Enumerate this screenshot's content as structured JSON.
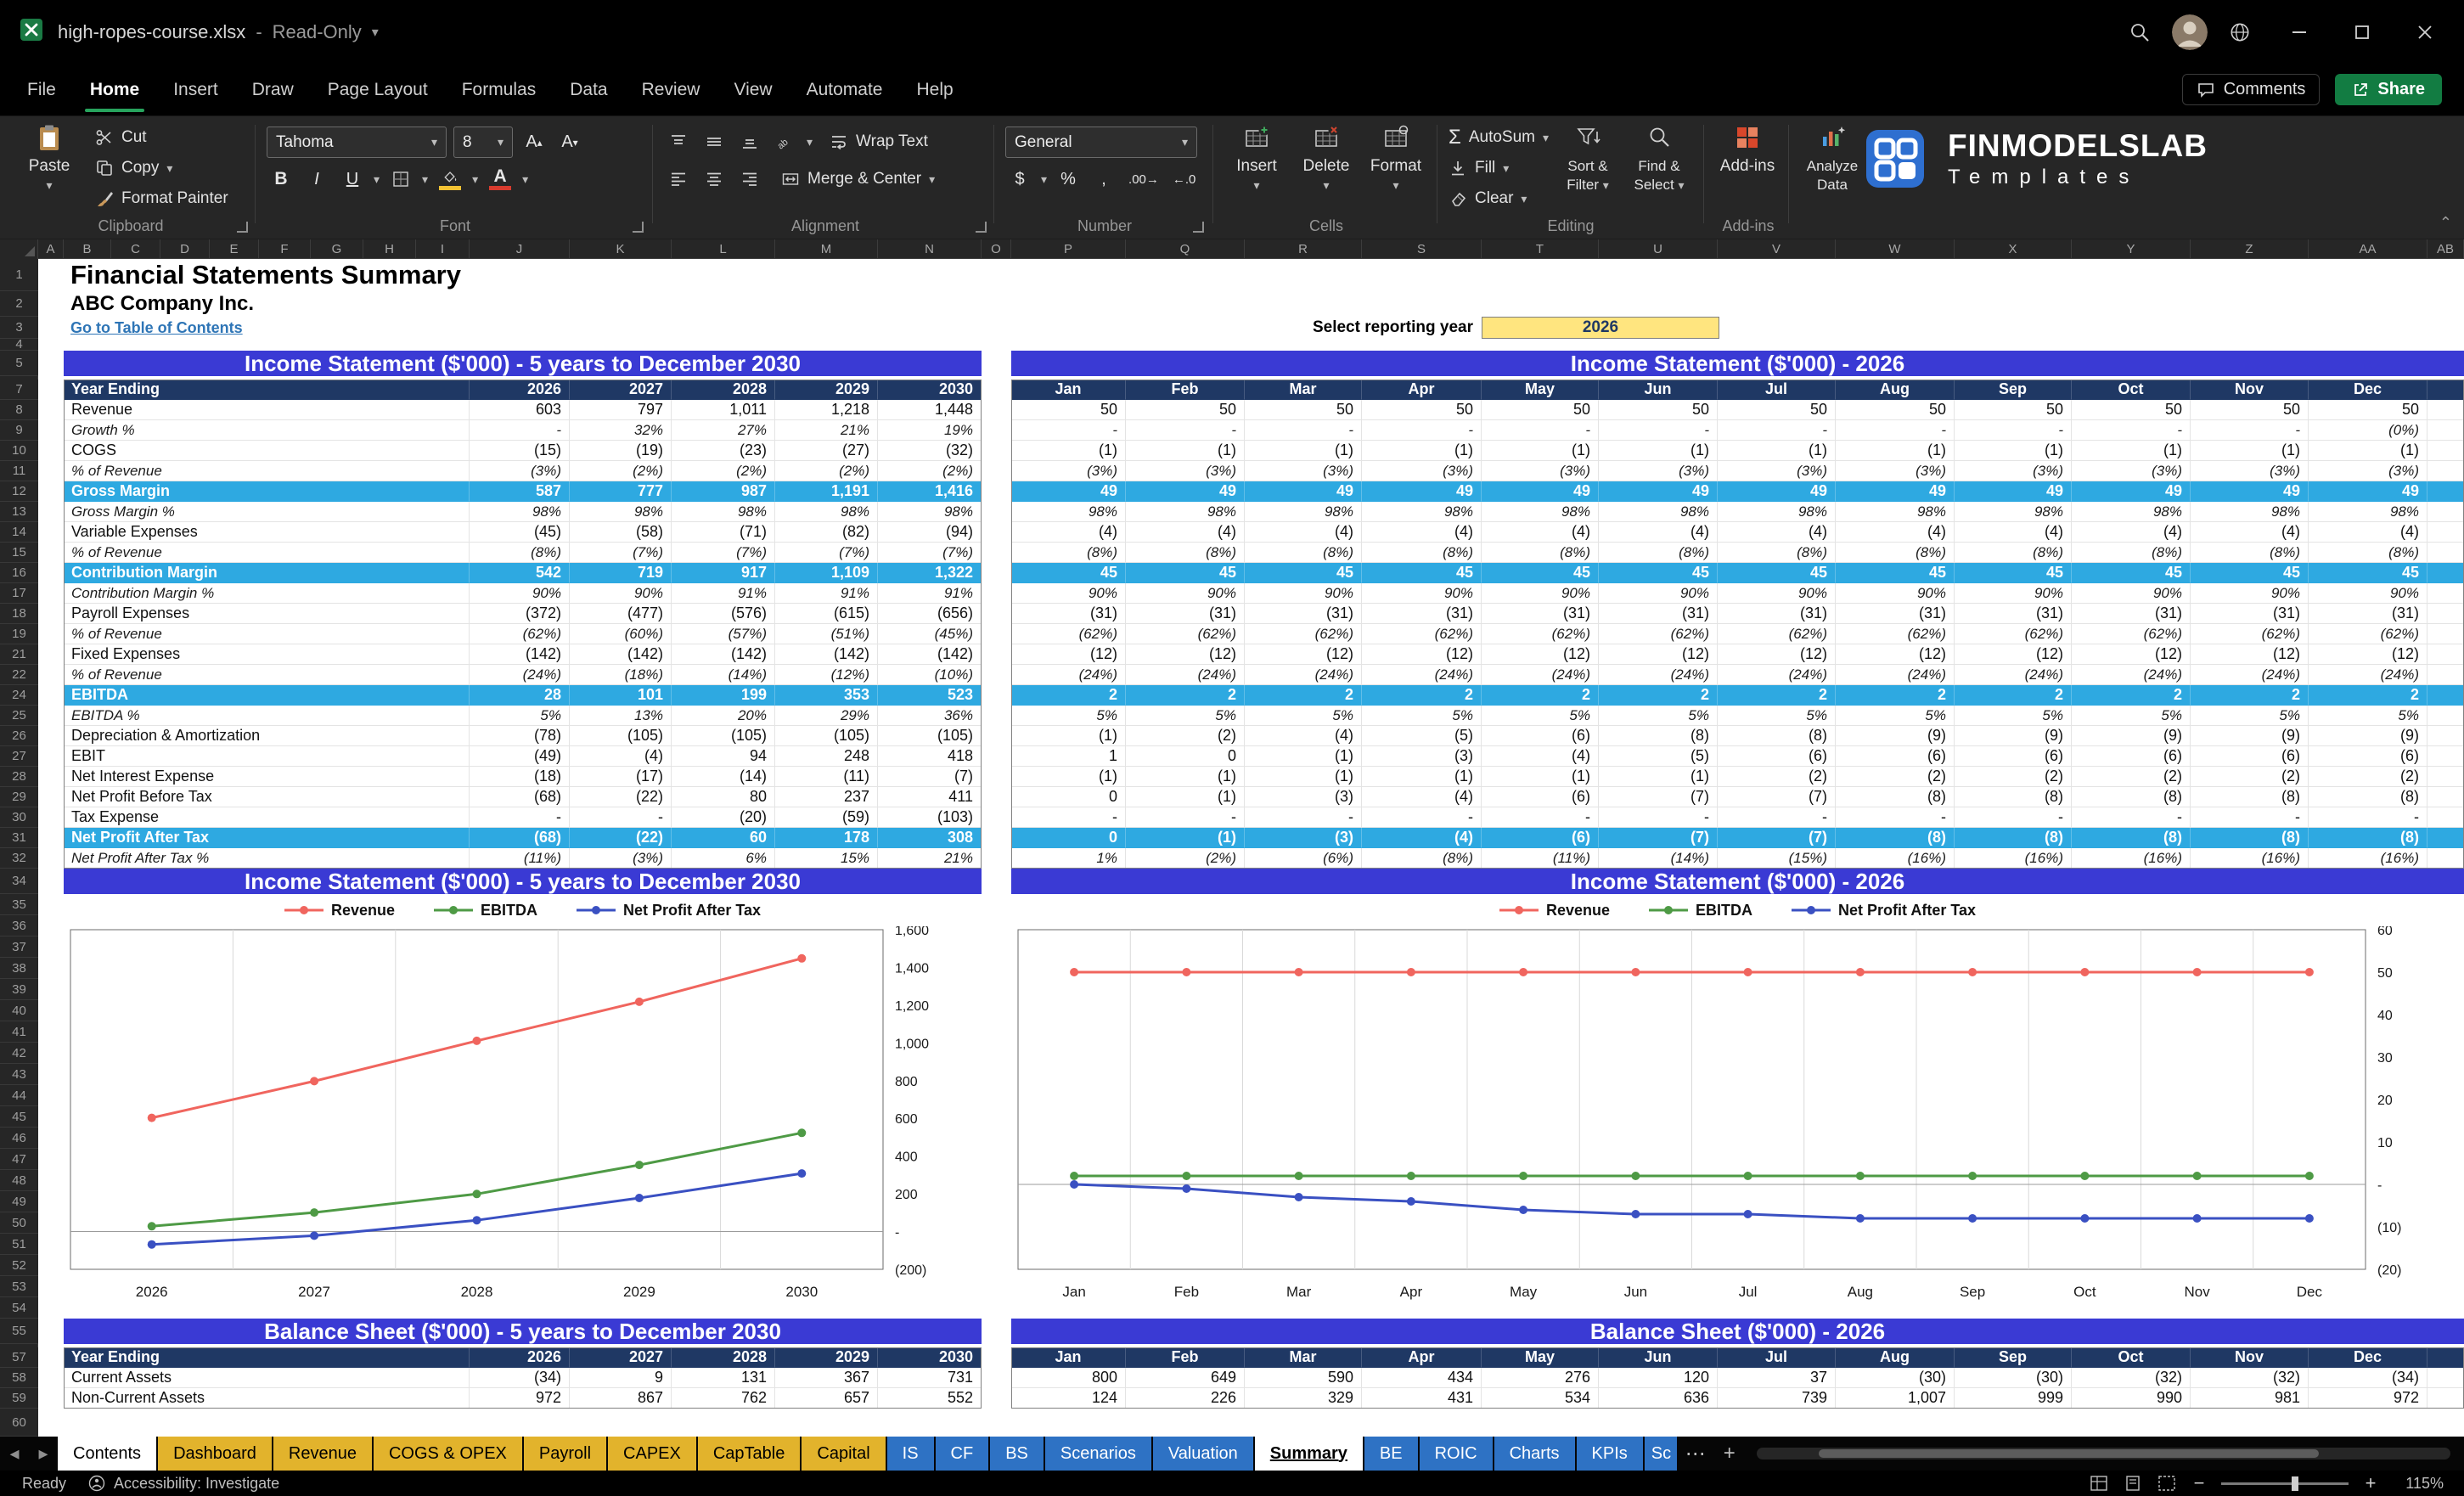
{
  "window": {
    "title": "high-ropes-course.xlsx",
    "mode": "Read-Only"
  },
  "menu": {
    "items": [
      "File",
      "Home",
      "Insert",
      "Draw",
      "Page Layout",
      "Formulas",
      "Data",
      "Review",
      "View",
      "Automate",
      "Help"
    ],
    "active": "Home",
    "comments_label": "Comments",
    "share_label": "Share"
  },
  "ribbon": {
    "clipboard": {
      "label": "Clipboard",
      "paste": "Paste",
      "cut": "Cut",
      "copy": "Copy",
      "format_painter": "Format Painter"
    },
    "font": {
      "label": "Font",
      "family": "Tahoma",
      "size": "8"
    },
    "alignment": {
      "label": "Alignment",
      "wrap_text": "Wrap Text",
      "merge_center": "Merge & Center"
    },
    "number": {
      "label": "Number",
      "format": "General"
    },
    "cells": {
      "label": "Cells",
      "insert": "Insert",
      "delete": "Delete",
      "format": "Format"
    },
    "editing": {
      "label": "Editing",
      "autosum": "AutoSum",
      "fill": "Fill",
      "clear": "Clear",
      "sort_filter": "Sort & Filter",
      "find_select": "Find & Select"
    },
    "addins": {
      "label": "Add-ins",
      "addins": "Add-ins",
      "analyze": "Analyze Data"
    },
    "brand": {
      "name": "FINMODELSLAB",
      "sub": "Templates"
    }
  },
  "sheet": {
    "col_letters": [
      "A",
      "B",
      "C",
      "D",
      "E",
      "F",
      "G",
      "H",
      "I",
      "J",
      "K",
      "L",
      "M",
      "N",
      "O",
      "P",
      "Q",
      "R",
      "S",
      "T",
      "U",
      "V",
      "W",
      "X",
      "Y",
      "Z",
      "AA",
      "AB"
    ],
    "row_numbers": [
      1,
      2,
      3,
      4,
      5,
      7,
      8,
      9,
      10,
      11,
      12,
      13,
      14,
      15,
      16,
      17,
      18,
      19,
      21,
      22,
      24,
      25,
      26,
      27,
      28,
      29,
      30,
      31,
      32,
      34,
      35,
      36,
      37,
      38,
      39,
      40,
      41,
      42,
      43,
      44,
      45,
      46,
      47,
      48,
      49,
      50,
      51,
      52,
      53,
      54,
      55,
      57,
      58,
      59,
      60
    ],
    "title": "Financial Statements Summary",
    "company": "ABC Company Inc.",
    "toc_link": "Go to Table of Contents",
    "select_year_label": "Select reporting year",
    "selected_year": "2026",
    "is_left_title": "Income Statement ($'000) - 5 years to December 2030",
    "is_right_title": "Income Statement ($'000) - 2026",
    "bs_left_title": "Balance Sheet ($'000) - 5 years to December 2030",
    "bs_right_title": "Balance Sheet ($'000) - 2026",
    "year_ending_label": "Year Ending",
    "years": [
      "2026",
      "2027",
      "2028",
      "2029",
      "2030"
    ],
    "months": [
      "Jan",
      "Feb",
      "Mar",
      "Apr",
      "May",
      "Jun",
      "Jul",
      "Aug",
      "Sep",
      "Oct",
      "Nov",
      "Dec"
    ],
    "is_rows": [
      {
        "n": 8,
        "label": "Revenue",
        "cls": "n",
        "left": [
          "603",
          "797",
          "1,011",
          "1,218",
          "1,448"
        ],
        "right": [
          "50",
          "50",
          "50",
          "50",
          "50",
          "50",
          "50",
          "50",
          "50",
          "50",
          "50",
          "50"
        ]
      },
      {
        "n": 9,
        "label": "Growth %",
        "cls": "i",
        "left": [
          "-",
          "32%",
          "27%",
          "21%",
          "19%"
        ],
        "right": [
          "-",
          "-",
          "-",
          "-",
          "-",
          "-",
          "-",
          "-",
          "-",
          "-",
          "-",
          "(0%)"
        ]
      },
      {
        "n": 10,
        "label": "COGS",
        "cls": "n",
        "left": [
          "(15)",
          "(19)",
          "(23)",
          "(27)",
          "(32)"
        ],
        "right": [
          "(1)",
          "(1)",
          "(1)",
          "(1)",
          "(1)",
          "(1)",
          "(1)",
          "(1)",
          "(1)",
          "(1)",
          "(1)",
          "(1)"
        ]
      },
      {
        "n": 11,
        "label": "% of Revenue",
        "cls": "i",
        "left": [
          "(3%)",
          "(2%)",
          "(2%)",
          "(2%)",
          "(2%)"
        ],
        "right": [
          "(3%)",
          "(3%)",
          "(3%)",
          "(3%)",
          "(3%)",
          "(3%)",
          "(3%)",
          "(3%)",
          "(3%)",
          "(3%)",
          "(3%)",
          "(3%)"
        ]
      },
      {
        "n": 12,
        "label": "Gross Margin",
        "cls": "hl",
        "left": [
          "587",
          "777",
          "987",
          "1,191",
          "1,416"
        ],
        "right": [
          "49",
          "49",
          "49",
          "49",
          "49",
          "49",
          "49",
          "49",
          "49",
          "49",
          "49",
          "49"
        ]
      },
      {
        "n": 13,
        "label": "Gross Margin %",
        "cls": "i",
        "left": [
          "98%",
          "98%",
          "98%",
          "98%",
          "98%"
        ],
        "right": [
          "98%",
          "98%",
          "98%",
          "98%",
          "98%",
          "98%",
          "98%",
          "98%",
          "98%",
          "98%",
          "98%",
          "98%"
        ]
      },
      {
        "n": 14,
        "label": "Variable Expenses",
        "cls": "n",
        "left": [
          "(45)",
          "(58)",
          "(71)",
          "(82)",
          "(94)"
        ],
        "right": [
          "(4)",
          "(4)",
          "(4)",
          "(4)",
          "(4)",
          "(4)",
          "(4)",
          "(4)",
          "(4)",
          "(4)",
          "(4)",
          "(4)"
        ]
      },
      {
        "n": 15,
        "label": "% of Revenue",
        "cls": "i",
        "left": [
          "(8%)",
          "(7%)",
          "(7%)",
          "(7%)",
          "(7%)"
        ],
        "right": [
          "(8%)",
          "(8%)",
          "(8%)",
          "(8%)",
          "(8%)",
          "(8%)",
          "(8%)",
          "(8%)",
          "(8%)",
          "(8%)",
          "(8%)",
          "(8%)"
        ]
      },
      {
        "n": 16,
        "label": "Contribution Margin",
        "cls": "hl",
        "left": [
          "542",
          "719",
          "917",
          "1,109",
          "1,322"
        ],
        "right": [
          "45",
          "45",
          "45",
          "45",
          "45",
          "45",
          "45",
          "45",
          "45",
          "45",
          "45",
          "45"
        ]
      },
      {
        "n": 17,
        "label": "Contribution Margin %",
        "cls": "i",
        "left": [
          "90%",
          "90%",
          "91%",
          "91%",
          "91%"
        ],
        "right": [
          "90%",
          "90%",
          "90%",
          "90%",
          "90%",
          "90%",
          "90%",
          "90%",
          "90%",
          "90%",
          "90%",
          "90%"
        ]
      },
      {
        "n": 18,
        "label": "Payroll Expenses",
        "cls": "n",
        "left": [
          "(372)",
          "(477)",
          "(576)",
          "(615)",
          "(656)"
        ],
        "right": [
          "(31)",
          "(31)",
          "(31)",
          "(31)",
          "(31)",
          "(31)",
          "(31)",
          "(31)",
          "(31)",
          "(31)",
          "(31)",
          "(31)"
        ]
      },
      {
        "n": 19,
        "label": "% of Revenue",
        "cls": "i",
        "left": [
          "(62%)",
          "(60%)",
          "(57%)",
          "(51%)",
          "(45%)"
        ],
        "right": [
          "(62%)",
          "(62%)",
          "(62%)",
          "(62%)",
          "(62%)",
          "(62%)",
          "(62%)",
          "(62%)",
          "(62%)",
          "(62%)",
          "(62%)",
          "(62%)"
        ]
      },
      {
        "n": 21,
        "label": "Fixed Expenses",
        "cls": "n",
        "left": [
          "(142)",
          "(142)",
          "(142)",
          "(142)",
          "(142)"
        ],
        "right": [
          "(12)",
          "(12)",
          "(12)",
          "(12)",
          "(12)",
          "(12)",
          "(12)",
          "(12)",
          "(12)",
          "(12)",
          "(12)",
          "(12)"
        ]
      },
      {
        "n": 22,
        "label": "% of Revenue",
        "cls": "i",
        "left": [
          "(24%)",
          "(18%)",
          "(14%)",
          "(12%)",
          "(10%)"
        ],
        "right": [
          "(24%)",
          "(24%)",
          "(24%)",
          "(24%)",
          "(24%)",
          "(24%)",
          "(24%)",
          "(24%)",
          "(24%)",
          "(24%)",
          "(24%)",
          "(24%)"
        ]
      },
      {
        "n": 24,
        "label": "EBITDA",
        "cls": "hl",
        "left": [
          "28",
          "101",
          "199",
          "353",
          "523"
        ],
        "right": [
          "2",
          "2",
          "2",
          "2",
          "2",
          "2",
          "2",
          "2",
          "2",
          "2",
          "2",
          "2"
        ]
      },
      {
        "n": 25,
        "label": "EBITDA %",
        "cls": "i",
        "left": [
          "5%",
          "13%",
          "20%",
          "29%",
          "36%"
        ],
        "right": [
          "5%",
          "5%",
          "5%",
          "5%",
          "5%",
          "5%",
          "5%",
          "5%",
          "5%",
          "5%",
          "5%",
          "5%"
        ]
      },
      {
        "n": 26,
        "label": "Depreciation & Amortization",
        "cls": "n",
        "left": [
          "(78)",
          "(105)",
          "(105)",
          "(105)",
          "(105)"
        ],
        "right": [
          "(1)",
          "(2)",
          "(4)",
          "(5)",
          "(6)",
          "(8)",
          "(8)",
          "(9)",
          "(9)",
          "(9)",
          "(9)",
          "(9)"
        ]
      },
      {
        "n": 27,
        "label": "EBIT",
        "cls": "n",
        "left": [
          "(49)",
          "(4)",
          "94",
          "248",
          "418"
        ],
        "right": [
          "1",
          "0",
          "(1)",
          "(3)",
          "(4)",
          "(5)",
          "(6)",
          "(6)",
          "(6)",
          "(6)",
          "(6)",
          "(6)"
        ]
      },
      {
        "n": 28,
        "label": "Net Interest Expense",
        "cls": "n",
        "left": [
          "(18)",
          "(17)",
          "(14)",
          "(11)",
          "(7)"
        ],
        "right": [
          "(1)",
          "(1)",
          "(1)",
          "(1)",
          "(1)",
          "(1)",
          "(2)",
          "(2)",
          "(2)",
          "(2)",
          "(2)",
          "(2)"
        ]
      },
      {
        "n": 29,
        "label": "Net Profit Before Tax",
        "cls": "n",
        "left": [
          "(68)",
          "(22)",
          "80",
          "237",
          "411"
        ],
        "right": [
          "0",
          "(1)",
          "(3)",
          "(4)",
          "(6)",
          "(7)",
          "(7)",
          "(8)",
          "(8)",
          "(8)",
          "(8)",
          "(8)"
        ]
      },
      {
        "n": 30,
        "label": "Tax Expense",
        "cls": "n",
        "left": [
          "-",
          "-",
          "(20)",
          "(59)",
          "(103)"
        ],
        "right": [
          "-",
          "-",
          "-",
          "-",
          "-",
          "-",
          "-",
          "-",
          "-",
          "-",
          "-",
          "-"
        ]
      },
      {
        "n": 31,
        "label": "Net Profit After Tax",
        "cls": "hl",
        "left": [
          "(68)",
          "(22)",
          "60",
          "178",
          "308"
        ],
        "right": [
          "0",
          "(1)",
          "(3)",
          "(4)",
          "(6)",
          "(7)",
          "(7)",
          "(8)",
          "(8)",
          "(8)",
          "(8)",
          "(8)"
        ]
      },
      {
        "n": 32,
        "label": "Net Profit After Tax %",
        "cls": "i",
        "left": [
          "(11%)",
          "(3%)",
          "6%",
          "15%",
          "21%"
        ],
        "right": [
          "1%",
          "(2%)",
          "(6%)",
          "(8%)",
          "(11%)",
          "(14%)",
          "(15%)",
          "(16%)",
          "(16%)",
          "(16%)",
          "(16%)",
          "(16%)"
        ]
      }
    ],
    "bs_rows": [
      {
        "n": 58,
        "label": "Current Assets",
        "cls": "n",
        "left": [
          "(34)",
          "9",
          "131",
          "367",
          "731"
        ],
        "right": [
          "800",
          "649",
          "590",
          "434",
          "276",
          "120",
          "37",
          "(30)",
          "(30)",
          "(32)",
          "(32)",
          "(34)"
        ]
      },
      {
        "n": 59,
        "label": "Non-Current Assets",
        "cls": "n",
        "left": [
          "972",
          "867",
          "762",
          "657",
          "552"
        ],
        "right": [
          "124",
          "226",
          "329",
          "431",
          "534",
          "636",
          "739",
          "1,007",
          "999",
          "990",
          "981",
          "972"
        ]
      }
    ]
  },
  "chart_data": [
    {
      "type": "line",
      "title": "Income Statement ($'000) - 5 years to December 2030",
      "x": [
        "2026",
        "2027",
        "2028",
        "2029",
        "2030"
      ],
      "series": [
        {
          "name": "Revenue",
          "color": "#f0655e",
          "values": [
            603,
            797,
            1011,
            1218,
            1448
          ]
        },
        {
          "name": "EBITDA",
          "color": "#4e9a45",
          "values": [
            28,
            101,
            199,
            353,
            523
          ]
        },
        {
          "name": "Net Profit After Tax",
          "color": "#3a50c2",
          "values": [
            -68,
            -22,
            60,
            178,
            308
          ]
        }
      ],
      "ylim": [
        -200,
        1600
      ],
      "ytick": 200,
      "ytick_labels": [
        "(200)",
        "-",
        "200",
        "400",
        "600",
        "800",
        "1,000",
        "1,200",
        "1,400",
        "1,600"
      ],
      "legend_position": "top",
      "y_axis_side": "right",
      "gridlines": "vertical"
    },
    {
      "type": "line",
      "title": "Income Statement ($'000) - 2026",
      "x": [
        "Jan",
        "Feb",
        "Mar",
        "Apr",
        "May",
        "Jun",
        "Jul",
        "Aug",
        "Sep",
        "Oct",
        "Nov",
        "Dec"
      ],
      "series": [
        {
          "name": "Revenue",
          "color": "#f0655e",
          "values": [
            50,
            50,
            50,
            50,
            50,
            50,
            50,
            50,
            50,
            50,
            50,
            50
          ]
        },
        {
          "name": "EBITDA",
          "color": "#4e9a45",
          "values": [
            2,
            2,
            2,
            2,
            2,
            2,
            2,
            2,
            2,
            2,
            2,
            2
          ]
        },
        {
          "name": "Net Profit After Tax",
          "color": "#3a50c2",
          "values": [
            0,
            -1,
            -3,
            -4,
            -6,
            -7,
            -7,
            -8,
            -8,
            -8,
            -8,
            -8
          ]
        }
      ],
      "ylim": [
        -20,
        60
      ],
      "ytick": 10,
      "ytick_labels": [
        "(20)",
        "(10)",
        "-",
        "10",
        "20",
        "30",
        "40",
        "50",
        "60"
      ],
      "legend_position": "top",
      "y_axis_side": "right",
      "gridlines": "vertical"
    }
  ],
  "tabs": {
    "items": [
      {
        "label": "Contents",
        "color": "white"
      },
      {
        "label": "Dashboard",
        "color": "yellow"
      },
      {
        "label": "Revenue",
        "color": "yellow"
      },
      {
        "label": "COGS & OPEX",
        "color": "yellow"
      },
      {
        "label": "Payroll",
        "color": "yellow"
      },
      {
        "label": "CAPEX",
        "color": "yellow"
      },
      {
        "label": "CapTable",
        "color": "yellow"
      },
      {
        "label": "Capital",
        "color": "yellow"
      },
      {
        "label": "IS",
        "color": "blue"
      },
      {
        "label": "CF",
        "color": "blue"
      },
      {
        "label": "BS",
        "color": "blue"
      },
      {
        "label": "Scenarios",
        "color": "blue"
      },
      {
        "label": "Valuation",
        "color": "blue"
      },
      {
        "label": "Summary",
        "color": "active"
      },
      {
        "label": "BE",
        "color": "blue"
      },
      {
        "label": "ROIC",
        "color": "blue"
      },
      {
        "label": "Charts",
        "color": "blue"
      },
      {
        "label": "KPIs",
        "color": "blue"
      },
      {
        "label": "Sc",
        "color": "blue",
        "cut": true
      }
    ],
    "active": "Summary"
  },
  "status": {
    "ready": "Ready",
    "accessibility": "Accessibility: Investigate",
    "zoom": "115%"
  }
}
